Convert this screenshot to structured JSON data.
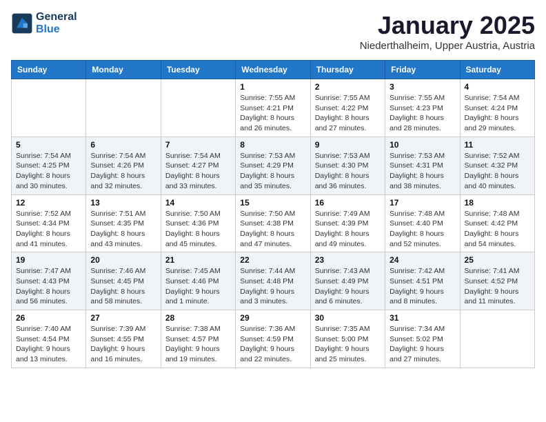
{
  "logo": {
    "text_general": "General",
    "text_blue": "Blue"
  },
  "header": {
    "month": "January 2025",
    "location": "Niederthalheim, Upper Austria, Austria"
  },
  "weekdays": [
    "Sunday",
    "Monday",
    "Tuesday",
    "Wednesday",
    "Thursday",
    "Friday",
    "Saturday"
  ],
  "weeks": [
    [
      {
        "day": "",
        "detail": ""
      },
      {
        "day": "",
        "detail": ""
      },
      {
        "day": "",
        "detail": ""
      },
      {
        "day": "1",
        "detail": "Sunrise: 7:55 AM\nSunset: 4:21 PM\nDaylight: 8 hours and 26 minutes."
      },
      {
        "day": "2",
        "detail": "Sunrise: 7:55 AM\nSunset: 4:22 PM\nDaylight: 8 hours and 27 minutes."
      },
      {
        "day": "3",
        "detail": "Sunrise: 7:55 AM\nSunset: 4:23 PM\nDaylight: 8 hours and 28 minutes."
      },
      {
        "day": "4",
        "detail": "Sunrise: 7:54 AM\nSunset: 4:24 PM\nDaylight: 8 hours and 29 minutes."
      }
    ],
    [
      {
        "day": "5",
        "detail": "Sunrise: 7:54 AM\nSunset: 4:25 PM\nDaylight: 8 hours and 30 minutes."
      },
      {
        "day": "6",
        "detail": "Sunrise: 7:54 AM\nSunset: 4:26 PM\nDaylight: 8 hours and 32 minutes."
      },
      {
        "day": "7",
        "detail": "Sunrise: 7:54 AM\nSunset: 4:27 PM\nDaylight: 8 hours and 33 minutes."
      },
      {
        "day": "8",
        "detail": "Sunrise: 7:53 AM\nSunset: 4:29 PM\nDaylight: 8 hours and 35 minutes."
      },
      {
        "day": "9",
        "detail": "Sunrise: 7:53 AM\nSunset: 4:30 PM\nDaylight: 8 hours and 36 minutes."
      },
      {
        "day": "10",
        "detail": "Sunrise: 7:53 AM\nSunset: 4:31 PM\nDaylight: 8 hours and 38 minutes."
      },
      {
        "day": "11",
        "detail": "Sunrise: 7:52 AM\nSunset: 4:32 PM\nDaylight: 8 hours and 40 minutes."
      }
    ],
    [
      {
        "day": "12",
        "detail": "Sunrise: 7:52 AM\nSunset: 4:34 PM\nDaylight: 8 hours and 41 minutes."
      },
      {
        "day": "13",
        "detail": "Sunrise: 7:51 AM\nSunset: 4:35 PM\nDaylight: 8 hours and 43 minutes."
      },
      {
        "day": "14",
        "detail": "Sunrise: 7:50 AM\nSunset: 4:36 PM\nDaylight: 8 hours and 45 minutes."
      },
      {
        "day": "15",
        "detail": "Sunrise: 7:50 AM\nSunset: 4:38 PM\nDaylight: 8 hours and 47 minutes."
      },
      {
        "day": "16",
        "detail": "Sunrise: 7:49 AM\nSunset: 4:39 PM\nDaylight: 8 hours and 49 minutes."
      },
      {
        "day": "17",
        "detail": "Sunrise: 7:48 AM\nSunset: 4:40 PM\nDaylight: 8 hours and 52 minutes."
      },
      {
        "day": "18",
        "detail": "Sunrise: 7:48 AM\nSunset: 4:42 PM\nDaylight: 8 hours and 54 minutes."
      }
    ],
    [
      {
        "day": "19",
        "detail": "Sunrise: 7:47 AM\nSunset: 4:43 PM\nDaylight: 8 hours and 56 minutes."
      },
      {
        "day": "20",
        "detail": "Sunrise: 7:46 AM\nSunset: 4:45 PM\nDaylight: 8 hours and 58 minutes."
      },
      {
        "day": "21",
        "detail": "Sunrise: 7:45 AM\nSunset: 4:46 PM\nDaylight: 9 hours and 1 minute."
      },
      {
        "day": "22",
        "detail": "Sunrise: 7:44 AM\nSunset: 4:48 PM\nDaylight: 9 hours and 3 minutes."
      },
      {
        "day": "23",
        "detail": "Sunrise: 7:43 AM\nSunset: 4:49 PM\nDaylight: 9 hours and 6 minutes."
      },
      {
        "day": "24",
        "detail": "Sunrise: 7:42 AM\nSunset: 4:51 PM\nDaylight: 9 hours and 8 minutes."
      },
      {
        "day": "25",
        "detail": "Sunrise: 7:41 AM\nSunset: 4:52 PM\nDaylight: 9 hours and 11 minutes."
      }
    ],
    [
      {
        "day": "26",
        "detail": "Sunrise: 7:40 AM\nSunset: 4:54 PM\nDaylight: 9 hours and 13 minutes."
      },
      {
        "day": "27",
        "detail": "Sunrise: 7:39 AM\nSunset: 4:55 PM\nDaylight: 9 hours and 16 minutes."
      },
      {
        "day": "28",
        "detail": "Sunrise: 7:38 AM\nSunset: 4:57 PM\nDaylight: 9 hours and 19 minutes."
      },
      {
        "day": "29",
        "detail": "Sunrise: 7:36 AM\nSunset: 4:59 PM\nDaylight: 9 hours and 22 minutes."
      },
      {
        "day": "30",
        "detail": "Sunrise: 7:35 AM\nSunset: 5:00 PM\nDaylight: 9 hours and 25 minutes."
      },
      {
        "day": "31",
        "detail": "Sunrise: 7:34 AM\nSunset: 5:02 PM\nDaylight: 9 hours and 27 minutes."
      },
      {
        "day": "",
        "detail": ""
      }
    ]
  ]
}
